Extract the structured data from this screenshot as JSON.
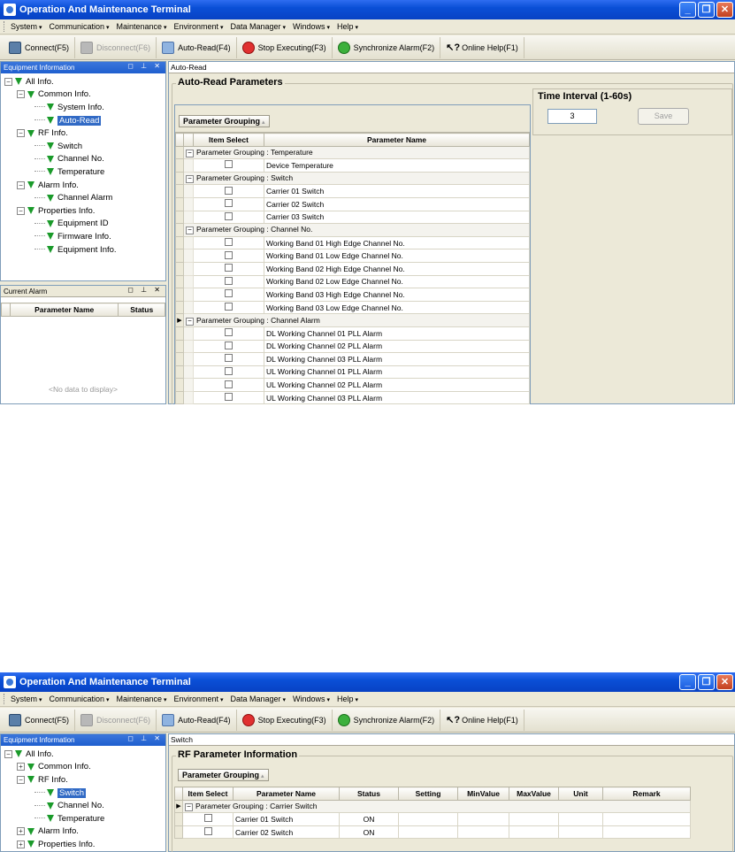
{
  "window": {
    "title": "Operation And Maintenance Terminal"
  },
  "menu": [
    "System",
    "Communication",
    "Maintenance",
    "Environment",
    "Data Manager",
    "Windows",
    "Help"
  ],
  "toolbar": {
    "connect": "Connect(F5)",
    "disconnect": "Disconnect(F6)",
    "auto_read": "Auto-Read(F4)",
    "stop": "Stop Executing(F3)",
    "sync": "Synchronize Alarm(F2)",
    "help": "Online Help(F1)"
  },
  "equipment_panel": {
    "title": "Equipment Information"
  },
  "tree": {
    "all": "All Info.",
    "common": "Common Info.",
    "system": "System Info.",
    "autoread": "Auto-Read",
    "rf": "RF Info.",
    "switch": "Switch",
    "channel": "Channel No.",
    "temperature": "Temperature",
    "alarm": "Alarm Info.",
    "channel_alarm": "Channel Alarm",
    "properties": "Properties Info.",
    "equipment_id": "Equipment ID",
    "firmware": "Firmware Info.",
    "equipment_info": "Equipment Info."
  },
  "current_alarm": {
    "title": "Current Alarm",
    "col_param": "Parameter Name",
    "col_status": "Status",
    "empty": "<No data to display>"
  },
  "autoread_view": {
    "tab": "Auto-Read",
    "group_title": "Auto-Read Parameters",
    "grouping_button": "Parameter Grouping",
    "col_item_select": "Item Select",
    "col_param_name": "Parameter Name",
    "time_interval_title": "Time Interval (1-60s)",
    "interval_value": "3",
    "save": "Save",
    "groups": [
      {
        "label": "Parameter Grouping : Temperature",
        "items": [
          "Device Temperature"
        ]
      },
      {
        "label": "Parameter Grouping : Switch",
        "items": [
          "Carrier 01 Switch",
          "Carrier 02 Switch",
          "Carrier 03 Switch"
        ]
      },
      {
        "label": "Parameter Grouping : Channel No.",
        "items": [
          "Working Band 01 High Edge Channel No.",
          "Working Band 01 Low Edge Channel No.",
          "Working Band 02 High Edge Channel No.",
          "Working Band 02 Low Edge Channel No.",
          "Working Band 03 High Edge Channel No.",
          "Working Band 03 Low Edge Channel No."
        ]
      },
      {
        "label": "Parameter Grouping : Channel Alarm",
        "items": [
          "DL Working Channel 01 PLL Alarm",
          "DL Working Channel 02 PLL Alarm",
          "DL Working Channel 03 PLL Alarm",
          "UL Working Channel 01 PLL Alarm",
          "UL Working Channel 02 PLL Alarm",
          "UL Working Channel 03 PLL Alarm"
        ]
      }
    ]
  },
  "switch_view": {
    "tab": "Switch",
    "group_title": "RF Parameter Information",
    "grouping_button": "Parameter Grouping",
    "cols": [
      "Item Select",
      "Parameter Name",
      "Status",
      "Setting",
      "MinValue",
      "MaxValue",
      "Unit",
      "Remark"
    ],
    "group_label": "Parameter Grouping : Carrier Switch",
    "rows": [
      {
        "name": "Carrier 01 Switch",
        "status": "ON"
      },
      {
        "name": "Carrier 02 Switch",
        "status": "ON"
      }
    ]
  }
}
